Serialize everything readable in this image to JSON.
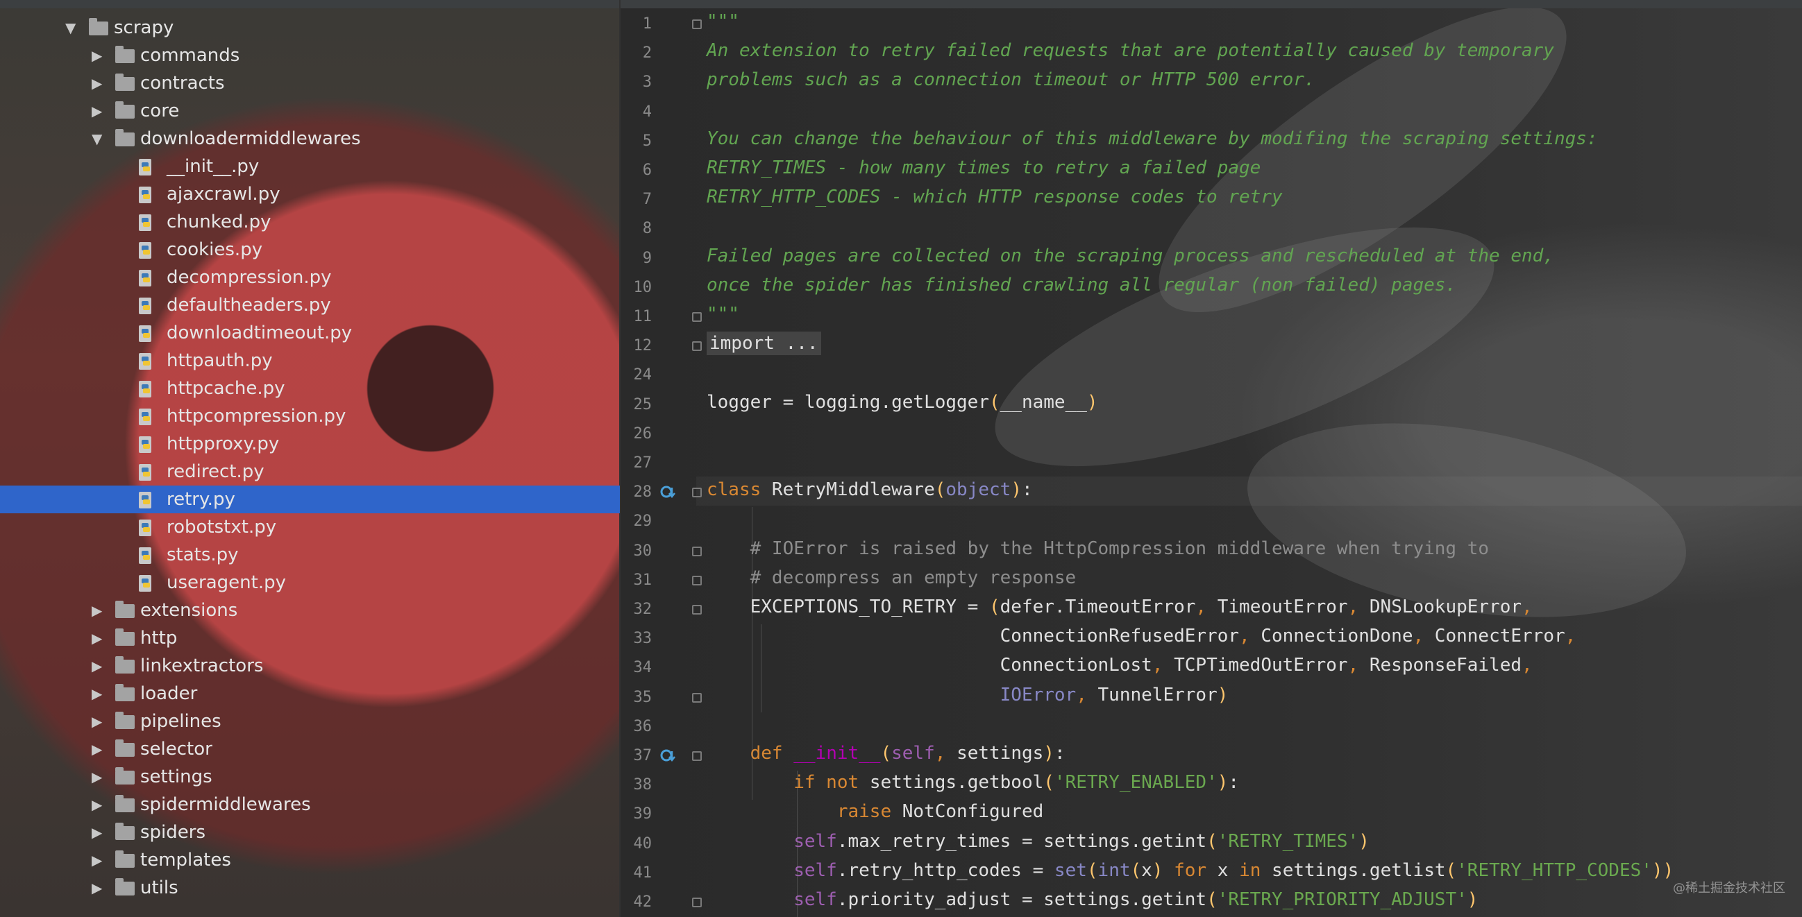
{
  "project_tree": {
    "items": [
      {
        "label": "scrapy",
        "type": "folder",
        "expanded": true,
        "depth": 0
      },
      {
        "label": "commands",
        "type": "folder",
        "expanded": false,
        "depth": 1
      },
      {
        "label": "contracts",
        "type": "folder",
        "expanded": false,
        "depth": 1
      },
      {
        "label": "core",
        "type": "folder",
        "expanded": false,
        "depth": 1
      },
      {
        "label": "downloadermiddlewares",
        "type": "folder",
        "expanded": true,
        "depth": 1
      },
      {
        "label": "__init__.py",
        "type": "file",
        "depth": 2
      },
      {
        "label": "ajaxcrawl.py",
        "type": "file",
        "depth": 2
      },
      {
        "label": "chunked.py",
        "type": "file",
        "depth": 2
      },
      {
        "label": "cookies.py",
        "type": "file",
        "depth": 2
      },
      {
        "label": "decompression.py",
        "type": "file",
        "depth": 2
      },
      {
        "label": "defaultheaders.py",
        "type": "file",
        "depth": 2
      },
      {
        "label": "downloadtimeout.py",
        "type": "file",
        "depth": 2
      },
      {
        "label": "httpauth.py",
        "type": "file",
        "depth": 2
      },
      {
        "label": "httpcache.py",
        "type": "file",
        "depth": 2
      },
      {
        "label": "httpcompression.py",
        "type": "file",
        "depth": 2
      },
      {
        "label": "httpproxy.py",
        "type": "file",
        "depth": 2
      },
      {
        "label": "redirect.py",
        "type": "file",
        "depth": 2
      },
      {
        "label": "retry.py",
        "type": "file",
        "depth": 2,
        "selected": true
      },
      {
        "label": "robotstxt.py",
        "type": "file",
        "depth": 2
      },
      {
        "label": "stats.py",
        "type": "file",
        "depth": 2
      },
      {
        "label": "useragent.py",
        "type": "file",
        "depth": 2
      },
      {
        "label": "extensions",
        "type": "folder",
        "expanded": false,
        "depth": 1
      },
      {
        "label": "http",
        "type": "folder",
        "expanded": false,
        "depth": 1
      },
      {
        "label": "linkextractors",
        "type": "folder",
        "expanded": false,
        "depth": 1
      },
      {
        "label": "loader",
        "type": "folder",
        "expanded": false,
        "depth": 1
      },
      {
        "label": "pipelines",
        "type": "folder",
        "expanded": false,
        "depth": 1
      },
      {
        "label": "selector",
        "type": "folder",
        "expanded": false,
        "depth": 1
      },
      {
        "label": "settings",
        "type": "folder",
        "expanded": false,
        "depth": 1
      },
      {
        "label": "spidermiddlewares",
        "type": "folder",
        "expanded": false,
        "depth": 1
      },
      {
        "label": "spiders",
        "type": "folder",
        "expanded": false,
        "depth": 1
      },
      {
        "label": "templates",
        "type": "folder",
        "expanded": false,
        "depth": 1
      },
      {
        "label": "utils",
        "type": "folder",
        "expanded": false,
        "depth": 1
      }
    ]
  },
  "editor": {
    "file": "retry.py",
    "current_line": "28",
    "lines": [
      {
        "num": "1",
        "fold": true,
        "segments": [
          {
            "c": "docline",
            "t": "\"\"\""
          }
        ]
      },
      {
        "num": "2",
        "segments": [
          {
            "c": "docline",
            "t": "An extension to retry failed requests that are potentially caused by temporary"
          }
        ]
      },
      {
        "num": "3",
        "segments": [
          {
            "c": "docline",
            "t": "problems such as a connection timeout or HTTP 500 error."
          }
        ]
      },
      {
        "num": "4",
        "segments": []
      },
      {
        "num": "5",
        "segments": [
          {
            "c": "docline",
            "t": "You can change the behaviour of this middleware by modifing the scraping settings:"
          }
        ]
      },
      {
        "num": "6",
        "segments": [
          {
            "c": "docline",
            "t": "RETRY_TIMES - how many times to retry a failed page"
          }
        ]
      },
      {
        "num": "7",
        "segments": [
          {
            "c": "docline",
            "t": "RETRY_HTTP_CODES - which HTTP response codes to retry"
          }
        ]
      },
      {
        "num": "8",
        "segments": []
      },
      {
        "num": "9",
        "segments": [
          {
            "c": "docline",
            "t": "Failed pages are collected on the scraping process and rescheduled at the end,"
          }
        ]
      },
      {
        "num": "10",
        "segments": [
          {
            "c": "docline",
            "t": "once the spider has finished crawling all regular (non failed) pages."
          }
        ]
      },
      {
        "num": "11",
        "fold": true,
        "segments": [
          {
            "c": "docline",
            "t": "\"\"\""
          }
        ]
      },
      {
        "num": "12",
        "fold": true,
        "segments": [
          {
            "c": "plain fold-import",
            "t": "import ..."
          }
        ]
      },
      {
        "num": "24",
        "segments": []
      },
      {
        "num": "25",
        "segments": [
          {
            "c": "plain",
            "t": "logger = logging.getLogger"
          },
          {
            "c": "paren",
            "t": "("
          },
          {
            "c": "plain",
            "t": "__name__"
          },
          {
            "c": "paren",
            "t": ")"
          }
        ]
      },
      {
        "num": "26",
        "segments": []
      },
      {
        "num": "27",
        "segments": []
      },
      {
        "num": "28",
        "fold": true,
        "icon": true,
        "segments": [
          {
            "c": "kw",
            "t": "class "
          },
          {
            "c": "plain",
            "t": "RetryMiddleware"
          },
          {
            "c": "paren",
            "t": "("
          },
          {
            "c": "builtin",
            "t": "object"
          },
          {
            "c": "paren",
            "t": ")"
          },
          {
            "c": "plain",
            "t": ":"
          }
        ]
      },
      {
        "num": "29",
        "segments": []
      },
      {
        "num": "30",
        "fold": true,
        "segments": [
          {
            "c": "cmt",
            "t": "    # IOError is raised by the HttpCompression middleware when trying to"
          }
        ]
      },
      {
        "num": "31",
        "fold": true,
        "segments": [
          {
            "c": "cmt",
            "t": "    # decompress an empty response"
          }
        ]
      },
      {
        "num": "32",
        "fold": true,
        "segments": [
          {
            "c": "plain",
            "t": "    EXCEPTIONS_TO_RETRY = "
          },
          {
            "c": "paren",
            "t": "("
          },
          {
            "c": "plain",
            "t": "defer.TimeoutError"
          },
          {
            "c": "kw",
            "t": ", "
          },
          {
            "c": "plain",
            "t": "TimeoutError"
          },
          {
            "c": "kw",
            "t": ", "
          },
          {
            "c": "plain",
            "t": "DNSLookupError"
          },
          {
            "c": "kw",
            "t": ","
          }
        ]
      },
      {
        "num": "33",
        "segments": [
          {
            "c": "plain",
            "t": "                           ConnectionRefusedError"
          },
          {
            "c": "kw",
            "t": ", "
          },
          {
            "c": "plain",
            "t": "ConnectionDone"
          },
          {
            "c": "kw",
            "t": ", "
          },
          {
            "c": "plain",
            "t": "ConnectError"
          },
          {
            "c": "kw",
            "t": ","
          }
        ]
      },
      {
        "num": "34",
        "segments": [
          {
            "c": "plain",
            "t": "                           ConnectionLost"
          },
          {
            "c": "kw",
            "t": ", "
          },
          {
            "c": "plain",
            "t": "TCPTimedOutError"
          },
          {
            "c": "kw",
            "t": ", "
          },
          {
            "c": "plain",
            "t": "ResponseFailed"
          },
          {
            "c": "kw",
            "t": ","
          }
        ]
      },
      {
        "num": "35",
        "fold": true,
        "segments": [
          {
            "c": "builtin",
            "t": "                           IOError"
          },
          {
            "c": "kw",
            "t": ", "
          },
          {
            "c": "plain",
            "t": "TunnelError"
          },
          {
            "c": "paren",
            "t": ")"
          }
        ]
      },
      {
        "num": "36",
        "segments": []
      },
      {
        "num": "37",
        "fold": true,
        "icon": true,
        "segments": [
          {
            "c": "kw",
            "t": "    def "
          },
          {
            "c": "dunder",
            "t": "__init__"
          },
          {
            "c": "paren",
            "t": "("
          },
          {
            "c": "self",
            "t": "self"
          },
          {
            "c": "kw",
            "t": ", "
          },
          {
            "c": "plain",
            "t": "settings"
          },
          {
            "c": "paren",
            "t": ")"
          },
          {
            "c": "plain",
            "t": ":"
          }
        ]
      },
      {
        "num": "38",
        "segments": [
          {
            "c": "kw",
            "t": "        if not "
          },
          {
            "c": "plain",
            "t": "settings.getbool"
          },
          {
            "c": "paren",
            "t": "("
          },
          {
            "c": "str",
            "t": "'RETRY_ENABLED'"
          },
          {
            "c": "paren",
            "t": ")"
          },
          {
            "c": "plain",
            "t": ":"
          }
        ]
      },
      {
        "num": "39",
        "segments": [
          {
            "c": "kw",
            "t": "            raise "
          },
          {
            "c": "plain",
            "t": "NotConfigured"
          }
        ]
      },
      {
        "num": "40",
        "segments": [
          {
            "c": "self",
            "t": "        self"
          },
          {
            "c": "plain",
            "t": ".max_retry_times = settings.getint"
          },
          {
            "c": "paren",
            "t": "("
          },
          {
            "c": "str",
            "t": "'RETRY_TIMES'"
          },
          {
            "c": "paren",
            "t": ")"
          }
        ]
      },
      {
        "num": "41",
        "segments": [
          {
            "c": "self",
            "t": "        self"
          },
          {
            "c": "plain",
            "t": ".retry_http_codes = "
          },
          {
            "c": "builtin",
            "t": "set"
          },
          {
            "c": "paren",
            "t": "("
          },
          {
            "c": "builtin",
            "t": "int"
          },
          {
            "c": "paren",
            "t": "("
          },
          {
            "c": "plain",
            "t": "x"
          },
          {
            "c": "paren",
            "t": ")"
          },
          {
            "c": "kw",
            "t": " for "
          },
          {
            "c": "plain",
            "t": "x"
          },
          {
            "c": "kw",
            "t": " in "
          },
          {
            "c": "plain",
            "t": "settings.getlist"
          },
          {
            "c": "paren",
            "t": "("
          },
          {
            "c": "str",
            "t": "'RETRY_HTTP_CODES'"
          },
          {
            "c": "paren",
            "t": "))"
          }
        ]
      },
      {
        "num": "42",
        "fold": true,
        "segments": [
          {
            "c": "self",
            "t": "        self"
          },
          {
            "c": "plain",
            "t": ".priority_adjust = settings.getint"
          },
          {
            "c": "paren",
            "t": "("
          },
          {
            "c": "str",
            "t": "'RETRY_PRIORITY_ADJUST'"
          },
          {
            "c": "paren",
            "t": ")"
          }
        ]
      }
    ]
  },
  "watermark": "@稀土掘金技术社区",
  "colors": {
    "selection": "#2f65ca",
    "docstring": "#62a551",
    "keyword": "#d98833",
    "string": "#6aa84f",
    "self": "#9d5eb0",
    "comment": "#8d8d8d"
  }
}
